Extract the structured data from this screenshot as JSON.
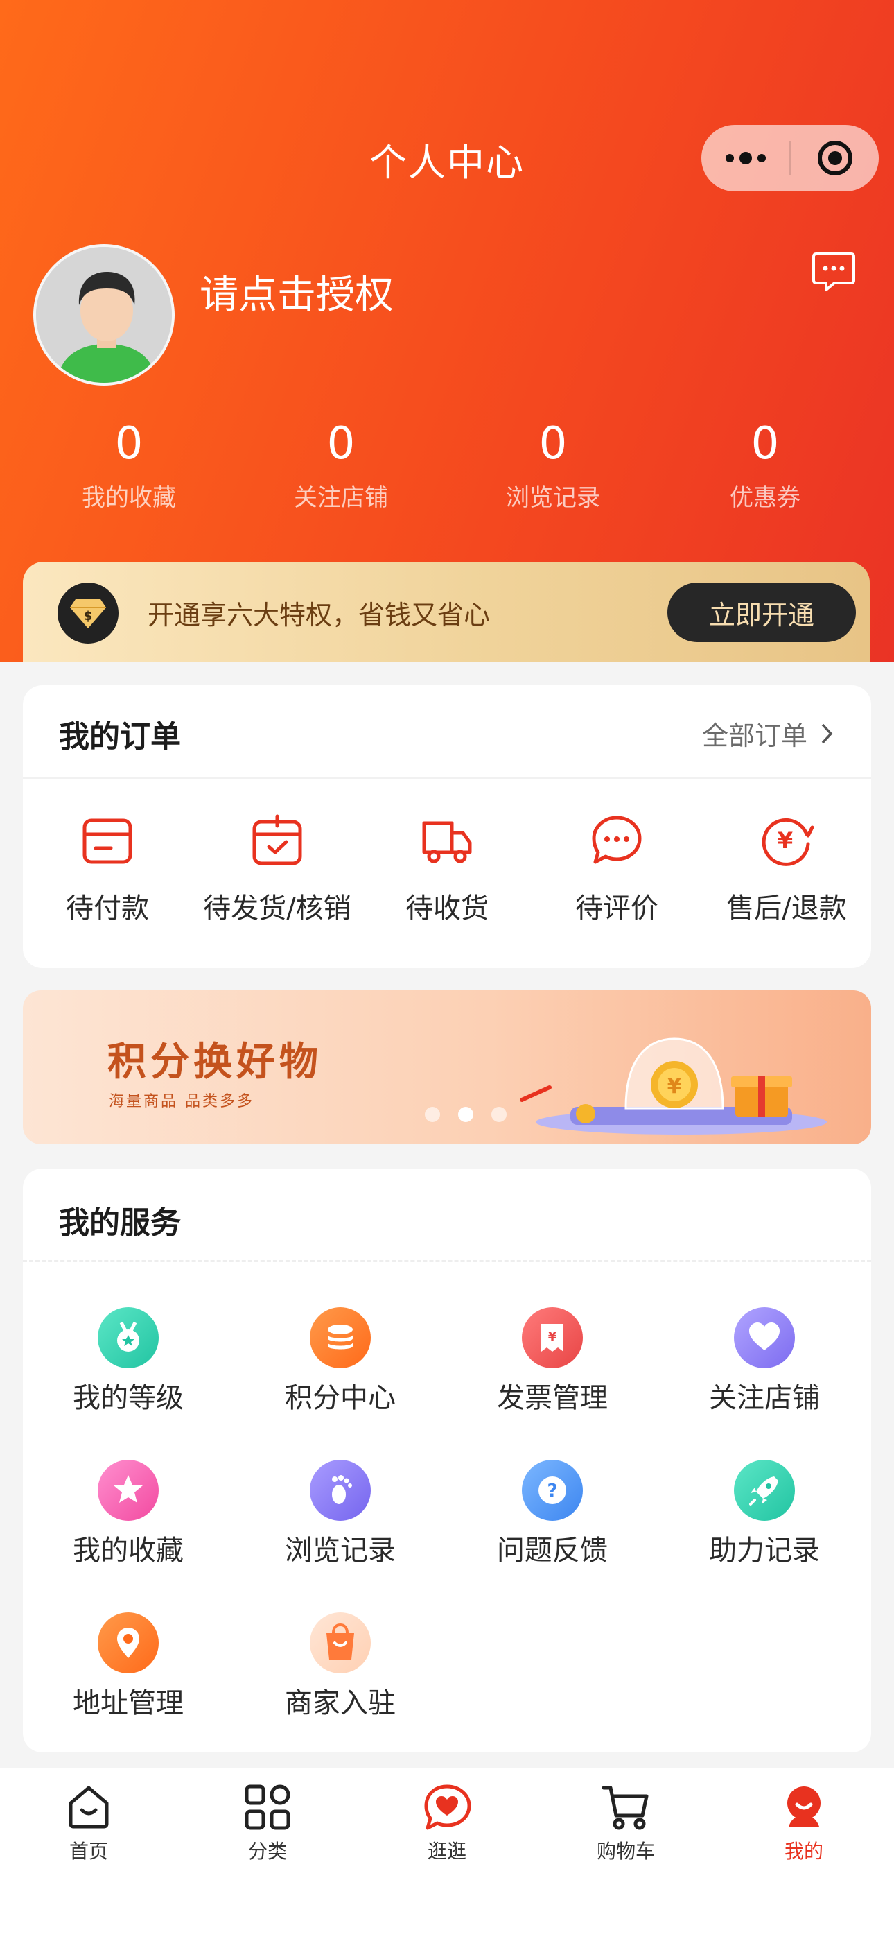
{
  "header": {
    "title": "个人中心"
  },
  "profile": {
    "auth_text": "请点击授权"
  },
  "stats": [
    {
      "value": "0",
      "label": "我的收藏"
    },
    {
      "value": "0",
      "label": "关注店铺"
    },
    {
      "value": "0",
      "label": "浏览记录"
    },
    {
      "value": "0",
      "label": "优惠券"
    }
  ],
  "vip": {
    "text": "开通享六大特权，省钱又省心",
    "button": "立即开通"
  },
  "orders": {
    "title": "我的订单",
    "all_label": "全部订单",
    "items": [
      {
        "label": "待付款",
        "icon": "wallet-icon"
      },
      {
        "label": "待发货/核销",
        "icon": "calendar-check-icon"
      },
      {
        "label": "待收货",
        "icon": "truck-icon"
      },
      {
        "label": "待评价",
        "icon": "chat-bubble-icon"
      },
      {
        "label": "售后/退款",
        "icon": "yen-refund-icon"
      }
    ]
  },
  "banner": {
    "title": "积分换好物",
    "subtitle": "海量商品  品类多多"
  },
  "services": {
    "title": "我的服务",
    "items": [
      {
        "label": "我的等级",
        "icon": "medal-icon",
        "color": "#2fd3b0"
      },
      {
        "label": "积分中心",
        "icon": "coins-icon",
        "color": "#ff7a2c"
      },
      {
        "label": "发票管理",
        "icon": "invoice-icon",
        "color": "#f05a5a"
      },
      {
        "label": "关注店铺",
        "icon": "heart-icon",
        "color": "#8d7cf6"
      },
      {
        "label": "我的收藏",
        "icon": "star-icon",
        "color": "#ff5fae"
      },
      {
        "label": "浏览记录",
        "icon": "footprint-icon",
        "color": "#8a7cf0"
      },
      {
        "label": "问题反馈",
        "icon": "question-icon",
        "color": "#4f9af5"
      },
      {
        "label": "助力记录",
        "icon": "rocket-icon",
        "color": "#2fd3b0"
      },
      {
        "label": "地址管理",
        "icon": "location-pin-icon",
        "color": "#ff7a2c"
      },
      {
        "label": "商家入驻",
        "icon": "shop-bag-icon",
        "color": "#ff7a4a"
      }
    ]
  },
  "tabbar": [
    {
      "label": "首页",
      "icon": "home-icon"
    },
    {
      "label": "分类",
      "icon": "grid-icon"
    },
    {
      "label": "逛逛",
      "icon": "heart-bubble-icon"
    },
    {
      "label": "购物车",
      "icon": "cart-icon"
    },
    {
      "label": "我的",
      "icon": "profile-icon",
      "active": true
    }
  ],
  "colors": {
    "brand": "#f4481f",
    "accent_red": "#e8321f",
    "vip_text": "#6b3e12"
  }
}
